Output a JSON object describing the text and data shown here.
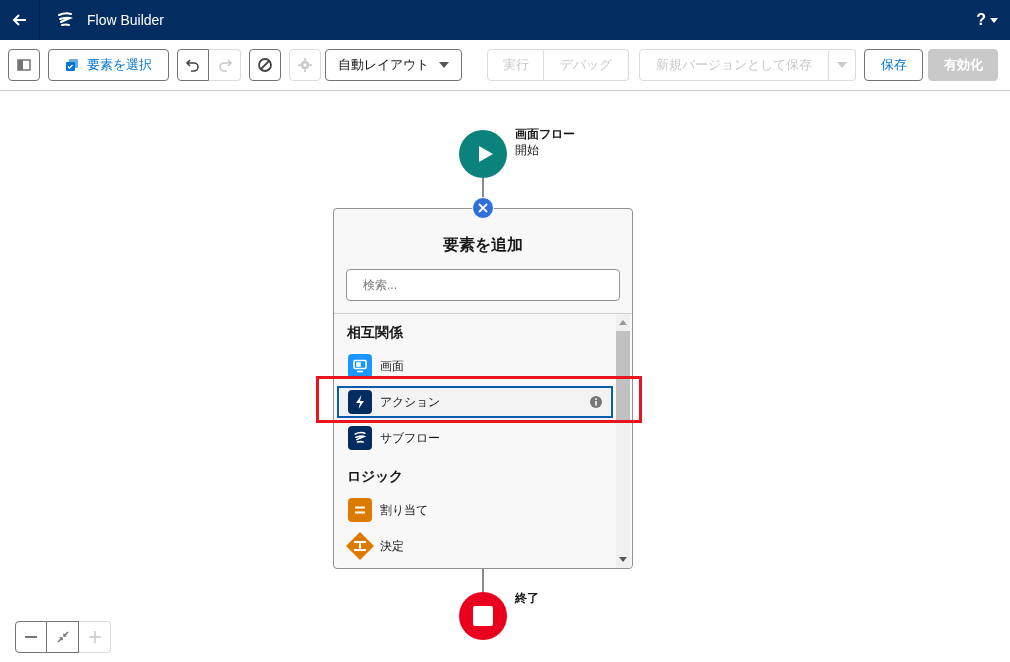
{
  "header": {
    "title": "Flow Builder",
    "help": "?"
  },
  "toolbar": {
    "select_elements": "要素を選択",
    "undo_disabled": false,
    "redo_disabled": true,
    "layout": "自動レイアウト",
    "run": {
      "label": "実行",
      "disabled": true
    },
    "debug": {
      "label": "デバッグ",
      "disabled": true
    },
    "save_as_new": {
      "label": "新規バージョンとして保存",
      "disabled": true
    },
    "save": {
      "label": "保存",
      "disabled": false
    },
    "activate": {
      "label": "有効化",
      "disabled": true
    }
  },
  "start_node": {
    "title": "画面フロー",
    "subtitle": "開始"
  },
  "end_node": {
    "label": "終了"
  },
  "add_element_panel": {
    "title": "要素を追加",
    "search": {
      "placeholder": "検索..."
    },
    "sections": [
      {
        "heading": "相互関係",
        "items": [
          {
            "label": "画面",
            "kind": "screen",
            "selected": false
          },
          {
            "label": "アクション",
            "kind": "action",
            "selected": true
          },
          {
            "label": "サブフロー",
            "kind": "subflow",
            "selected": false
          }
        ]
      },
      {
        "heading": "ロジック",
        "items": [
          {
            "label": "割り当て",
            "kind": "assignment",
            "selected": false
          },
          {
            "label": "決定",
            "kind": "decision",
            "selected": false
          }
        ]
      }
    ]
  },
  "zoom_controls": {
    "zoom_in_disabled": true
  }
}
